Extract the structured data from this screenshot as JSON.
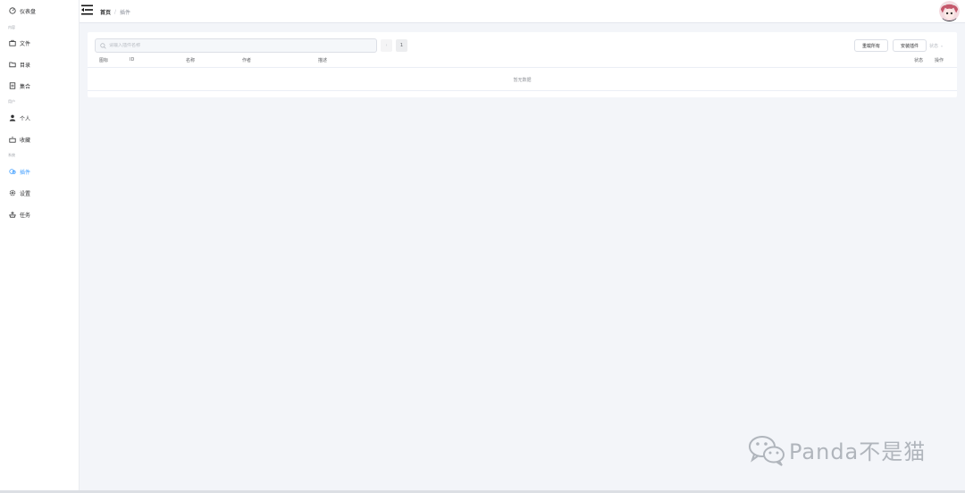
{
  "sidebar": {
    "dashboard": {
      "label": "仪表盘",
      "icon": "dashboard-icon"
    },
    "groups": {
      "content": "内容",
      "user": "用户",
      "system": "系统"
    },
    "items": {
      "files": {
        "label": "文件",
        "icon": "briefcase-icon"
      },
      "catalog": {
        "label": "目录",
        "icon": "folder-icon"
      },
      "topics": {
        "label": "集合",
        "icon": "collection-icon"
      },
      "personal": {
        "label": "个人",
        "icon": "user-icon"
      },
      "favorites": {
        "label": "收藏",
        "icon": "star-box-icon"
      },
      "plugins": {
        "label": "插件",
        "icon": "plugin-icon",
        "active": true
      },
      "settings": {
        "label": "设置",
        "icon": "gear-icon"
      },
      "tasks": {
        "label": "任务",
        "icon": "task-icon"
      }
    }
  },
  "header": {
    "breadcrumb": {
      "home": "首页",
      "separator": "/",
      "current": "插件"
    }
  },
  "toolbar": {
    "search_placeholder": "请输入插件名称",
    "prev_label": "‹",
    "page_number": "1",
    "reload_all_label": "重载所有",
    "install_label": "安装插件",
    "status_placeholder": "状态"
  },
  "table": {
    "columns": {
      "icon": "图标",
      "id": "ID",
      "name": "名称",
      "author": "作者",
      "description": "描述",
      "status": "状态",
      "actions": "操作"
    },
    "empty_text": "暂无数据"
  },
  "watermark": {
    "text": "Panda不是猫"
  },
  "colors": {
    "accent": "#409eff",
    "background": "#f3f5f9",
    "surface": "#ffffff"
  }
}
